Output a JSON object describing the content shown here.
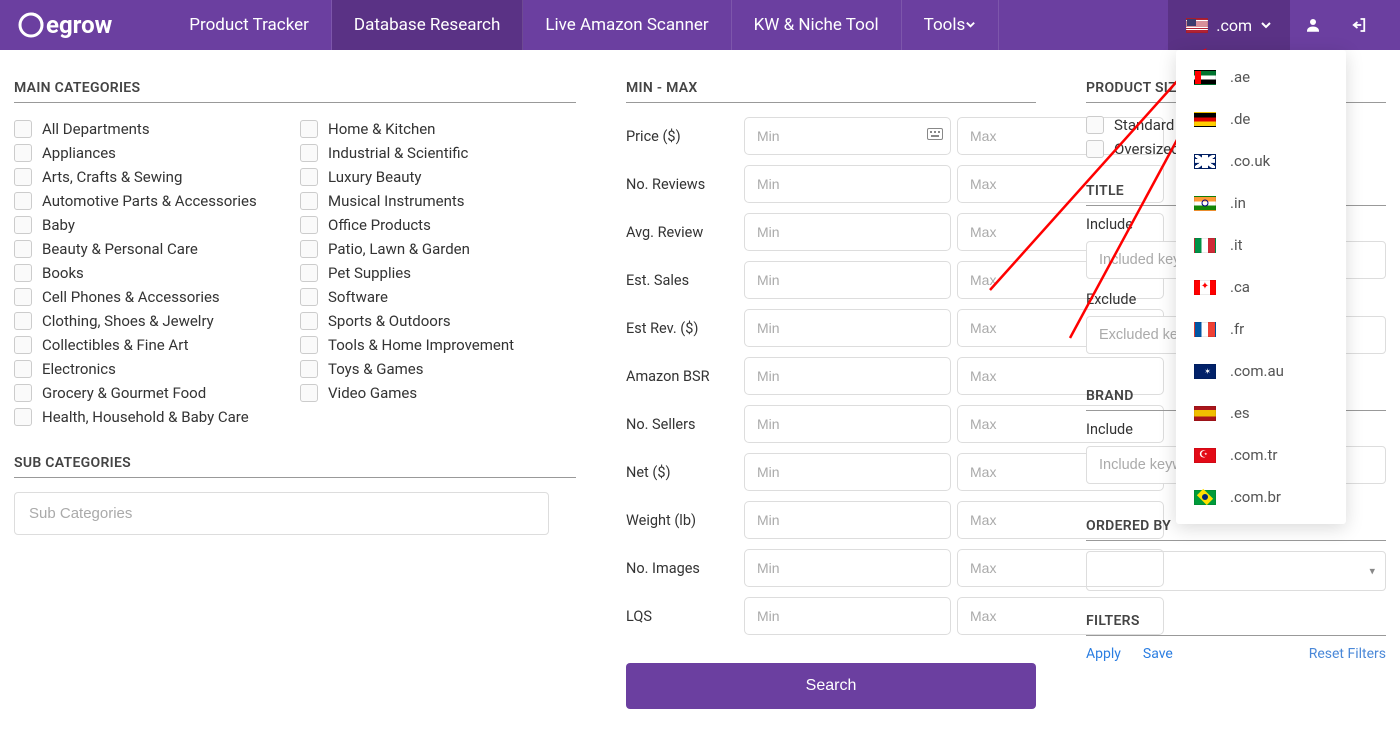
{
  "brand": "egrow",
  "nav": [
    {
      "label": "Product Tracker"
    },
    {
      "label": "Database Research",
      "active": true
    },
    {
      "label": "Live Amazon Scanner"
    },
    {
      "label": "KW & Niche Tool"
    },
    {
      "label": "Tools",
      "caret": true
    }
  ],
  "domain_selected": ".com",
  "domain_options": [
    {
      "code": "ae",
      "label": ".ae"
    },
    {
      "code": "de",
      "label": ".de"
    },
    {
      "code": "gb",
      "label": ".co.uk"
    },
    {
      "code": "in",
      "label": ".in"
    },
    {
      "code": "it",
      "label": ".it"
    },
    {
      "code": "ca",
      "label": ".ca"
    },
    {
      "code": "fr",
      "label": ".fr"
    },
    {
      "code": "au",
      "label": ".com.au"
    },
    {
      "code": "es",
      "label": ".es"
    },
    {
      "code": "tr",
      "label": ".com.tr"
    },
    {
      "code": "br",
      "label": ".com.br"
    }
  ],
  "sections": {
    "main_categories": "MAIN CATEGORIES",
    "sub_categories": "SUB CATEGORIES",
    "min_max": "MIN - MAX",
    "product_size": "PRODUCT SIZE",
    "title": "TITLE",
    "brand": "BRAND",
    "ordered_by": "ORDERED BY",
    "filters": "FILTERS"
  },
  "categories_col1": [
    "All Departments",
    "Appliances",
    "Arts, Crafts & Sewing",
    "Automotive Parts & Accessories",
    "Baby",
    "Beauty & Personal Care",
    "Books",
    "Cell Phones & Accessories",
    "Clothing, Shoes & Jewelry",
    "Collectibles & Fine Art",
    "Electronics",
    "Grocery & Gourmet Food",
    "Health, Household & Baby Care"
  ],
  "categories_col2": [
    "Home & Kitchen",
    "Industrial & Scientific",
    "Luxury Beauty",
    "Musical Instruments",
    "Office Products",
    "Patio, Lawn & Garden",
    "Pet Supplies",
    "Software",
    "Sports & Outdoors",
    "Tools & Home Improvement",
    "Toys & Games",
    "Video Games"
  ],
  "subcat_placeholder": "Sub Categories",
  "minmax_rows": [
    {
      "label": "Price ($)",
      "kb": true
    },
    {
      "label": "No. Reviews"
    },
    {
      "label": "Avg. Review"
    },
    {
      "label": "Est. Sales"
    },
    {
      "label": "Est Rev. ($)"
    },
    {
      "label": "Amazon BSR"
    },
    {
      "label": "No. Sellers"
    },
    {
      "label": "Net ($)"
    },
    {
      "label": "Weight (lb)"
    },
    {
      "label": "No. Images"
    },
    {
      "label": "LQS"
    }
  ],
  "placeholders": {
    "min": "Min",
    "max": "Max"
  },
  "search_label": "Search",
  "product_size_options": [
    "Standard",
    "Oversized"
  ],
  "title_block": {
    "include_label": "Include",
    "exclude_label": "Exclude",
    "include_ph": "Included keywords",
    "exclude_ph": "Excluded keywords"
  },
  "brand_block": {
    "include_label": "Include",
    "include_ph": "Include keywords"
  },
  "filters_actions": {
    "apply": "Apply",
    "save": "Save",
    "reset": "Reset Filters"
  }
}
